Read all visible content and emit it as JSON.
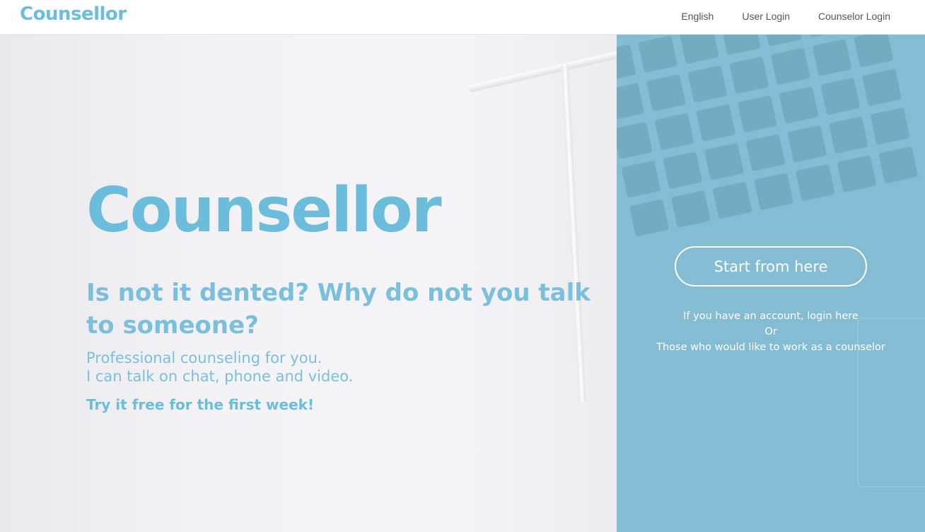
{
  "header": {
    "brand": "Counsellor",
    "nav": {
      "language": "English",
      "user_login": "User Login",
      "counselor_login": "Counselor Login"
    }
  },
  "hero": {
    "title": "Counsellor",
    "question": "Is not it dented? Why do not you talk to someone?",
    "description_line1": "Professional counseling for you.",
    "description_line2": "I can talk on chat, phone and video.",
    "trial": "Try it free for the first week!"
  },
  "panel": {
    "cta_label": "Start from here",
    "login_link": "If you have an account, login here",
    "or_text": "Or",
    "counselor_link": "Those who would like to work as a counselor"
  },
  "colors": {
    "brand": "#6cbcdc",
    "panel": "#84bcd3",
    "text_light": "#7bbfdc"
  }
}
